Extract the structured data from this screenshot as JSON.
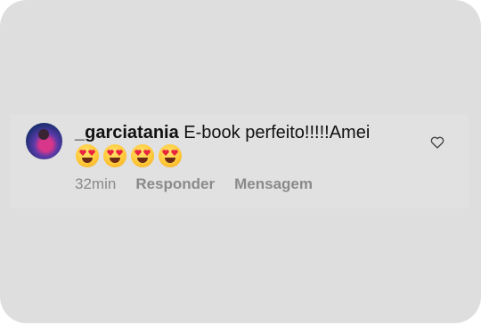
{
  "comment": {
    "username": "_garciatania",
    "text": "E-book perfeito!!!!!Amei",
    "emojis": [
      "heart-eyes-emoji",
      "heart-eyes-emoji",
      "heart-eyes-emoji",
      "heart-eyes-emoji"
    ],
    "time": "32min",
    "reply_label": "Responder",
    "message_label": "Mensagem"
  },
  "colors": {
    "card_bg": "#dedede",
    "text": "#111111",
    "meta": "#8a8a8a",
    "emoji_face": "#ffc93a",
    "emoji_heart": "#e8243f"
  },
  "icons": {
    "like": "heart-outline-icon"
  }
}
